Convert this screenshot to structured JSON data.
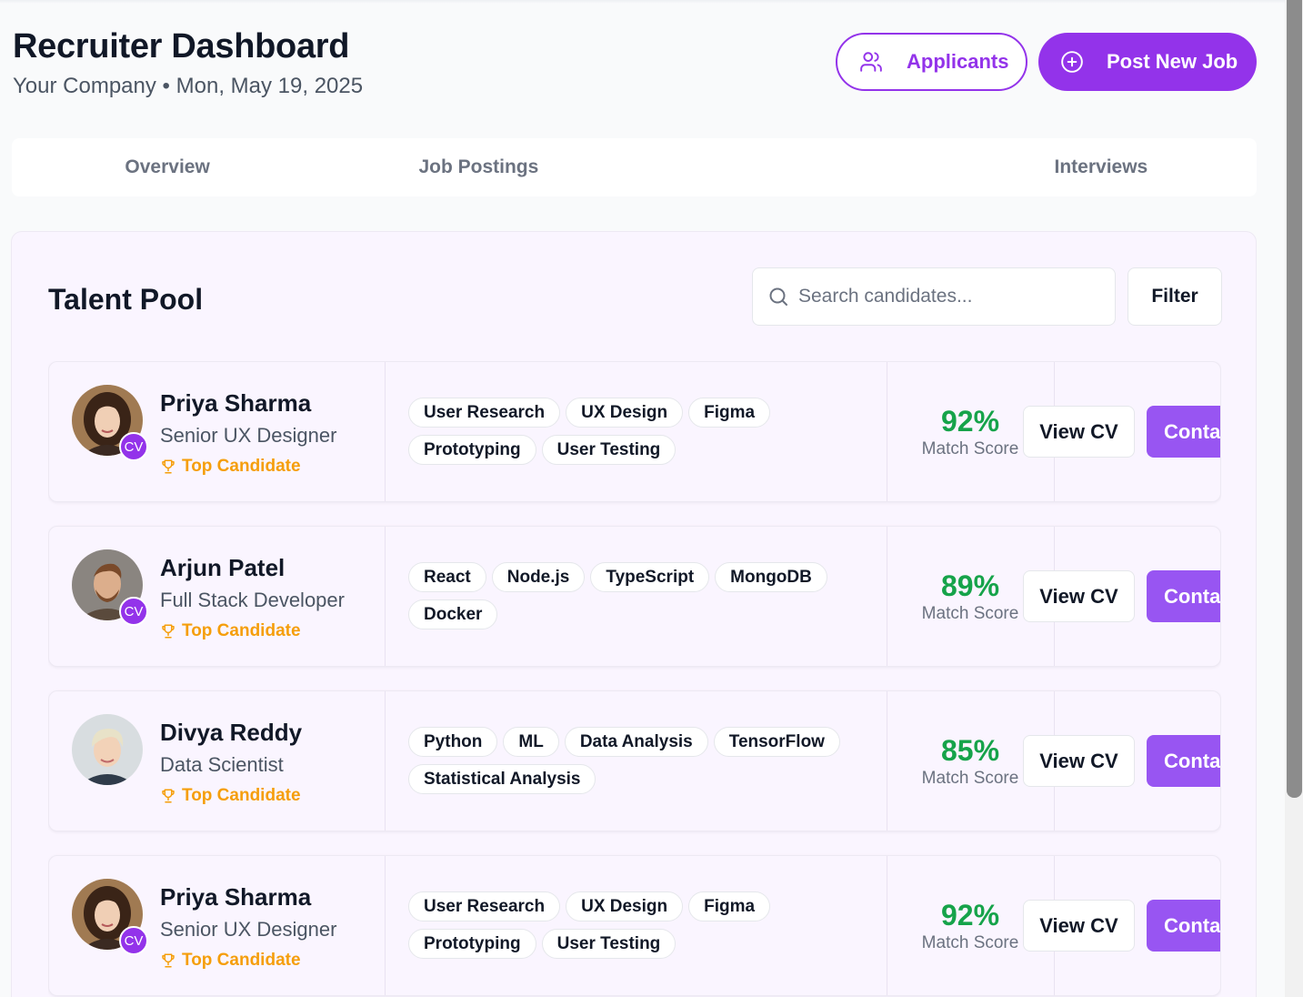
{
  "header": {
    "title": "Recruiter Dashboard",
    "company": "Your Company",
    "separator": "•",
    "date": "Mon, May 19, 2025"
  },
  "actions": {
    "applicants_label": "Applicants",
    "applicants_icon": "users-icon",
    "post_job_label": "Post New Job",
    "post_job_icon": "plus-circle-icon"
  },
  "tabs": [
    {
      "label": "Overview"
    },
    {
      "label": "Job Postings"
    },
    {
      "label": ""
    },
    {
      "label": "Interviews"
    }
  ],
  "talent_pool": {
    "title": "Talent Pool",
    "search_placeholder": "Search candidates...",
    "filter_label": "Filter"
  },
  "candidates": [
    {
      "name": "Priya Sharma",
      "role": "Senior UX Designer",
      "badge": "Top Candidate",
      "cv_badge": "CV",
      "skills": [
        "User Research",
        "UX Design",
        "Figma",
        "Prototyping",
        "User Testing"
      ],
      "match": "92%",
      "match_label": "Match Score",
      "view_cv": "View CV",
      "contact": "Contact"
    },
    {
      "name": "Arjun Patel",
      "role": "Full Stack Developer",
      "badge": "Top Candidate",
      "cv_badge": "CV",
      "skills": [
        "React",
        "Node.js",
        "TypeScript",
        "MongoDB",
        "Docker"
      ],
      "match": "89%",
      "match_label": "Match Score",
      "view_cv": "View CV",
      "contact": "Contact"
    },
    {
      "name": "Divya Reddy",
      "role": "Data Scientist",
      "badge": "Top Candidate",
      "cv_badge": "",
      "skills": [
        "Python",
        "ML",
        "Data Analysis",
        "TensorFlow",
        "Statistical Analysis"
      ],
      "match": "85%",
      "match_label": "Match Score",
      "view_cv": "View CV",
      "contact": "Contact"
    },
    {
      "name": "Priya Sharma",
      "role": "Senior UX Designer",
      "badge": "Top Candidate",
      "cv_badge": "CV",
      "skills": [
        "User Research",
        "UX Design",
        "Figma",
        "Prototyping",
        "User Testing"
      ],
      "match": "92%",
      "match_label": "Match Score",
      "view_cv": "View CV",
      "contact": "Contact"
    }
  ],
  "colors": {
    "accent": "#9333ea",
    "match_green": "#16a34a",
    "badge_amber": "#f59e0b"
  }
}
